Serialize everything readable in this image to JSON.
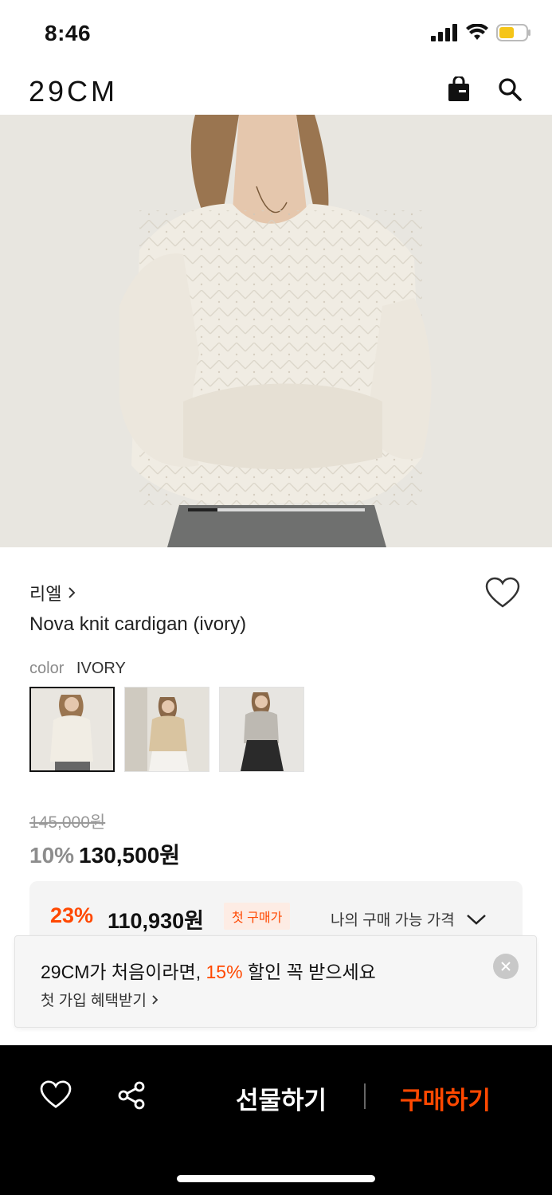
{
  "status_bar": {
    "time": "8:46",
    "icons": [
      "signal-icon",
      "wifi-icon",
      "battery-icon"
    ],
    "battery_color": "#f5c518"
  },
  "header": {
    "logo": "29CM",
    "actions": [
      "shopping-bag-icon",
      "search-icon"
    ]
  },
  "product_image": {
    "current_index": 1,
    "total": 6
  },
  "product": {
    "brand": "리엘",
    "name": "Nova knit cardigan (ivory)",
    "color_label": "color",
    "color_value": "IVORY",
    "swatches": [
      {
        "name": "ivory",
        "selected": true
      },
      {
        "name": "beige",
        "selected": false
      },
      {
        "name": "gray",
        "selected": false
      }
    ],
    "original_price": "145,000원",
    "discount_percent": "10%",
    "sale_price": "130,500원"
  },
  "my_price": {
    "discount_percent": "23%",
    "price": "110,930원",
    "badge": "첫 구매가",
    "available_label": "나의 구매 가능 가격"
  },
  "promo": {
    "title_prefix": "29CM가 처음이라면, ",
    "title_accent": "15%",
    "title_suffix": " 할인 꼭 받으세요",
    "link": "첫 가입 혜택받기"
  },
  "bottom_bar": {
    "gift_label": "선물하기",
    "buy_label": "구매하기"
  },
  "colors": {
    "accent": "#ff4800",
    "text": "#111111",
    "muted": "#8d8d8d"
  }
}
